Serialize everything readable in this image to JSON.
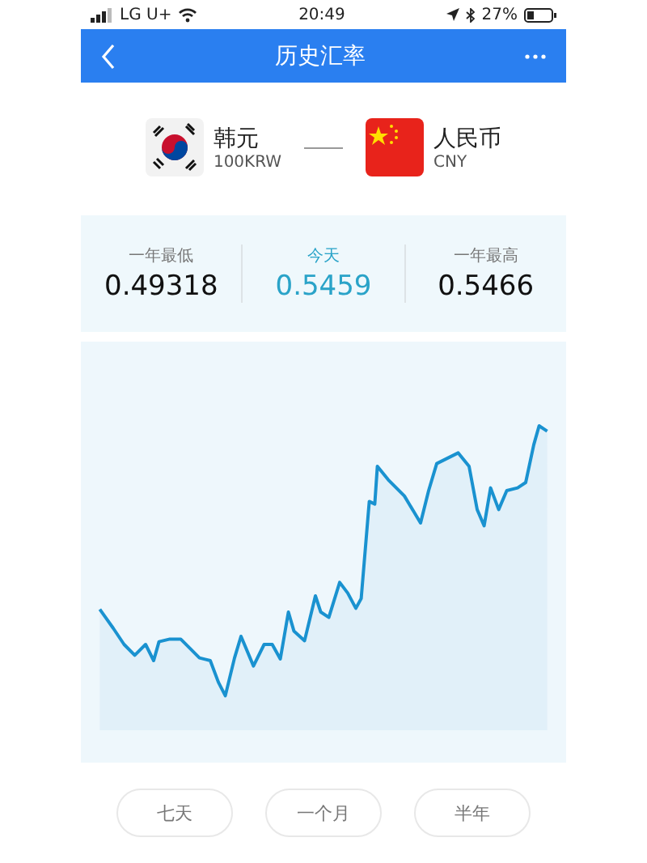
{
  "status_bar": {
    "carrier": "LG U+",
    "time": "20:49",
    "battery": "27%"
  },
  "nav": {
    "title": "历史汇率"
  },
  "pair": [
    {
      "name": "韩元",
      "code": "100KRW",
      "kind": "kr"
    },
    {
      "name": "人民币",
      "code": "CNY",
      "kind": "cn"
    }
  ],
  "stats": [
    {
      "label": "一年最低",
      "value": "0.49318",
      "highlight": false
    },
    {
      "label": "今天",
      "value": "0.5459",
      "highlight": true
    },
    {
      "label": "一年最高",
      "value": "0.5466",
      "highlight": false
    }
  ],
  "periods": [
    "七天",
    "一个月",
    "半年"
  ]
}
